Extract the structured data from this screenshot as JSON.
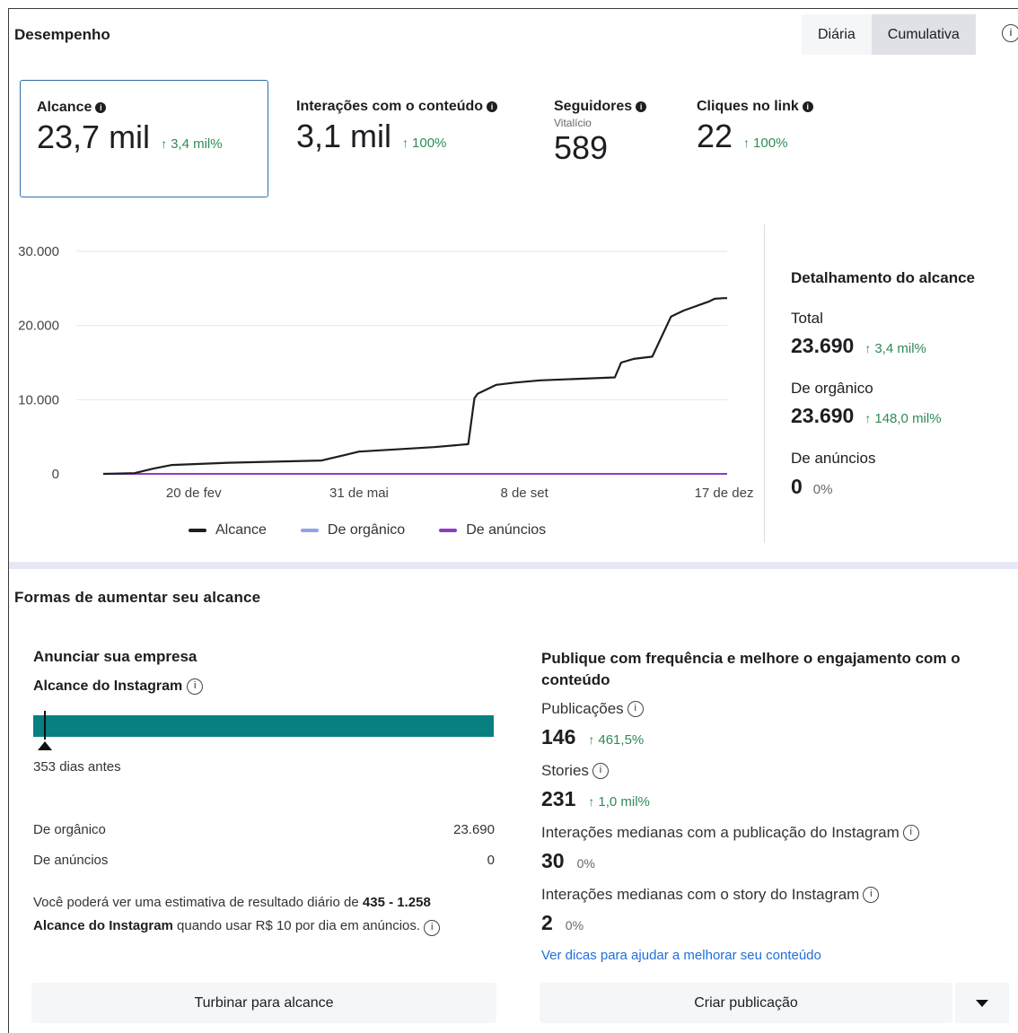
{
  "header": {
    "title": "Desempenho",
    "toggle": [
      "Diária",
      "Cumulativa"
    ],
    "info_glyph": "i"
  },
  "metrics": [
    {
      "label": "Alcance",
      "value": "23,7 mil",
      "trend": "3,4 mil%",
      "sub": ""
    },
    {
      "label": "Interações com o conteúdo",
      "value": "3,1 mil",
      "trend": "100%",
      "sub": ""
    },
    {
      "label": "Seguidores",
      "value": "589",
      "trend": "",
      "sub": "Vitalício"
    },
    {
      "label": "Cliques no link",
      "value": "22",
      "trend": "100%",
      "sub": ""
    }
  ],
  "chart_data": {
    "type": "line",
    "title": "",
    "xlabel": "",
    "ylabel": "",
    "yticks": [
      "0",
      "10.000",
      "20.000",
      "30.000"
    ],
    "ylim": [
      0,
      30000
    ],
    "xticks": [
      "20 de fev",
      "31 de mai",
      "8 de set",
      "17 de dez"
    ],
    "x": [
      0,
      0.05,
      0.08,
      0.11,
      0.2,
      0.35,
      0.41,
      0.47,
      0.53,
      0.585,
      0.595,
      0.6,
      0.63,
      0.66,
      0.7,
      0.82,
      0.83,
      0.85,
      0.88,
      0.91,
      0.93,
      0.97,
      0.98,
      0.995,
      1
    ],
    "series": [
      {
        "name": "Alcance",
        "color": "#1c1e21",
        "values": [
          0,
          100,
          700,
          1200,
          1500,
          1800,
          3000,
          3300,
          3600,
          4000,
          10200,
          10800,
          12000,
          12300,
          12600,
          13000,
          15000,
          15500,
          15800,
          21200,
          22000,
          23200,
          23600,
          23690,
          23690
        ]
      },
      {
        "name": "De orgânico",
        "color": "#8fa4e8",
        "values": [
          0,
          0
        ]
      },
      {
        "name": "De anúncios",
        "color": "#8a3ec4",
        "values": [
          0,
          0
        ]
      }
    ],
    "grid": true,
    "legend": "bottom"
  },
  "breakdown": {
    "title": "Detalhamento do alcance",
    "rows": [
      {
        "label": "Total",
        "value": "23.690",
        "trend": "3,4 mil%"
      },
      {
        "label": "De orgânico",
        "value": "23.690",
        "trend": "148,0 mil%"
      },
      {
        "label": "De anúncios",
        "value": "0",
        "pct": "0%"
      }
    ]
  },
  "grow": {
    "title": "Formas de aumentar seu alcance",
    "left": {
      "title": "Anunciar sua empresa",
      "subtitle": "Alcance do Instagram",
      "marker_fraction": 0.026,
      "days": "353 dias antes",
      "rows": [
        {
          "label": "De orgânico",
          "value": "23.690"
        },
        {
          "label": "De anúncios",
          "value": "0"
        }
      ],
      "estimate_pre": "Você poderá ver uma estimativa de resultado diário de ",
      "estimate_range": "435 - 1.258",
      "estimate_bold2": "Alcance do Instagram",
      "estimate_post": " quando usar R$ 10 por dia em anúncios.",
      "button": "Turbinar para alcance"
    },
    "right": {
      "title": "Publique com frequência e melhore o engajamento com o conteúdo",
      "items": [
        {
          "label": "Publicações",
          "value": "146",
          "trend": "461,5%"
        },
        {
          "label": "Stories",
          "value": "231",
          "trend": "1,0 mil%"
        },
        {
          "label": "Interações medianas com a publicação do Instagram",
          "value": "30",
          "pct": "0%"
        },
        {
          "label": "Interações medianas com o story do Instagram",
          "value": "2",
          "pct": "0%"
        }
      ],
      "link": "Ver dicas para ajudar a melhorar seu conteúdo",
      "button": "Criar publicação"
    }
  },
  "colors": {
    "accent": "#2e6da4",
    "trend": "#2e8b57",
    "progress": "#087f80",
    "link": "#216fdb"
  }
}
